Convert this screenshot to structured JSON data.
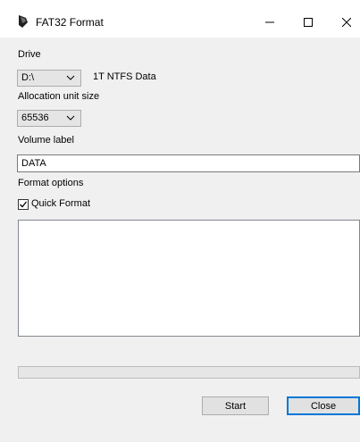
{
  "window": {
    "title": "FAT32 Format",
    "icon": "drive-format-icon",
    "controls": {
      "minimize": "minimize-icon",
      "maximize": "maximize-icon",
      "close": "close-icon"
    }
  },
  "drive": {
    "label": "Drive",
    "selected": "D:\\",
    "description": "1T NTFS Data"
  },
  "allocation": {
    "label": "Allocation unit size",
    "selected": "65536"
  },
  "volume": {
    "label": "Volume label",
    "value": "DATA"
  },
  "format_options": {
    "label": "Format options",
    "quick_format": {
      "label": "Quick Format",
      "checked": true
    }
  },
  "progress": {
    "value": 0
  },
  "buttons": {
    "start": "Start",
    "close": "Close"
  },
  "colors": {
    "window_bg": "#f0f0f0",
    "titlebar_bg": "#ffffff",
    "default_button_border": "#0078d7",
    "progress_fill": "#06b025"
  }
}
